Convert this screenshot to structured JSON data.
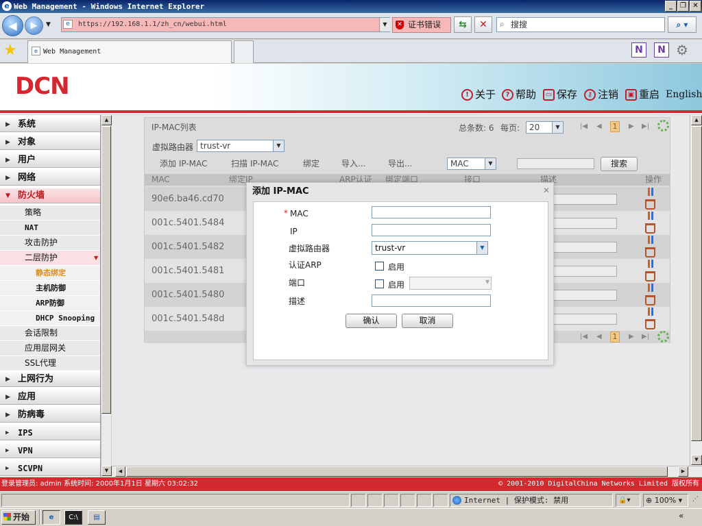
{
  "browser": {
    "window_title": "Web Management - Windows Internet Explorer",
    "url": "https://192.168.1.1/zh_cn/webui.html",
    "cert_error": "证书错误",
    "search_placeholder": "搜搜",
    "tab_title": "Web Management",
    "status_zone": "Internet | 保护模式: 禁用",
    "zoom": "100%"
  },
  "header": {
    "logo": "DCN",
    "menu": [
      {
        "label": "关于",
        "icon": "info-icon"
      },
      {
        "label": "帮助",
        "icon": "help-icon"
      },
      {
        "label": "保存",
        "icon": "save-icon"
      },
      {
        "label": "注销",
        "icon": "logout-icon"
      },
      {
        "label": "重启",
        "icon": "restart-icon"
      },
      {
        "label": "English"
      }
    ]
  },
  "sidebar": {
    "items": [
      {
        "label": "系统",
        "level": 1
      },
      {
        "label": "对象",
        "level": 1
      },
      {
        "label": "用户",
        "level": 1
      },
      {
        "label": "网络",
        "level": 1
      },
      {
        "label": "防火墙",
        "level": 1,
        "active": true
      },
      {
        "label": "策略",
        "level": 2
      },
      {
        "label": "NAT",
        "level": 2
      },
      {
        "label": "攻击防护",
        "level": 2
      },
      {
        "label": "二层防护",
        "level": 2,
        "open": true
      },
      {
        "label": "静态绑定",
        "level": 3,
        "selected": true
      },
      {
        "label": "主机防御",
        "level": 3
      },
      {
        "label": "ARP防御",
        "level": 3
      },
      {
        "label": "DHCP Snooping",
        "level": 3
      },
      {
        "label": "会话限制",
        "level": 2
      },
      {
        "label": "应用层网关",
        "level": 2
      },
      {
        "label": "SSL代理",
        "level": 2
      },
      {
        "label": "上网行为",
        "level": 1
      },
      {
        "label": "应用",
        "level": 1
      },
      {
        "label": "防病毒",
        "level": 1
      },
      {
        "label": "IPS",
        "level": 1
      },
      {
        "label": "VPN",
        "level": 1
      },
      {
        "label": "SCVPN",
        "level": 1
      }
    ]
  },
  "panel": {
    "title": "IP-MAC列表",
    "total_label": "总条数: 6",
    "per_page_label": "每页:",
    "per_page_value": "20",
    "current_page": "1",
    "vr_label": "虚拟路由器",
    "vr_value": "trust-vr",
    "toolbar": [
      "添加 IP-MAC",
      "扫描 IP-MAC",
      "绑定",
      "导入...",
      "导出..."
    ],
    "filter_value": "MAC",
    "search_btn": "搜索",
    "columns": [
      "MAC",
      "绑定IP",
      "ARP认证",
      "绑定端口",
      "接口",
      "描述",
      "操作"
    ],
    "rows": [
      "90e6.ba46.cd70",
      "001c.5401.5484",
      "001c.5401.5482",
      "001c.5401.5481",
      "001c.5401.5480",
      "001c.5401.548d"
    ]
  },
  "modal": {
    "title": "添加 IP-MAC",
    "required_mark": "*",
    "mac_label": "MAC",
    "ip_label": "IP",
    "vr_label": "虚拟路由器",
    "vr_value": "trust-vr",
    "arp_label": "认证ARP",
    "enable_label": "启用",
    "port_label": "端口",
    "desc_label": "描述",
    "ok": "确认",
    "cancel": "取消"
  },
  "status": {
    "left": "登录管理员: admin 系统时间: 2000年1月1日 星期六 03:02:32",
    "right": "© 2001-2010 DigitalChina Networks Limited 版权所有"
  },
  "taskbar": {
    "start": "开始"
  },
  "colors": {
    "brand_red": "#d32a2f",
    "ie_blue": "#0a246a",
    "selected_orange": "#e0901a"
  }
}
